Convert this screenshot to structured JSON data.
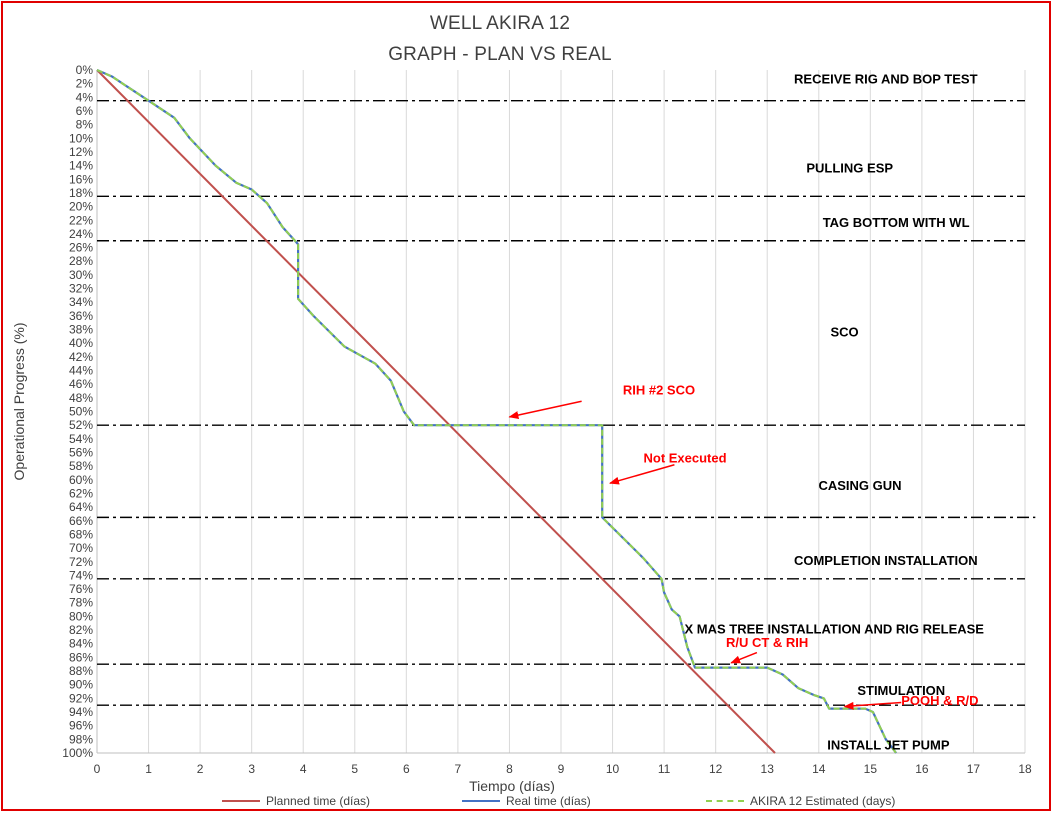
{
  "title_line1": "WELL AKIRA 12",
  "title_line2": "GRAPH  - PLAN VS REAL",
  "chart_data": {
    "type": "line",
    "title": "WELL AKIRA 12 GRAPH - PLAN VS REAL",
    "xlabel": "Tiempo (días)",
    "ylabel": "Operational Progress (%)",
    "xlim": [
      0,
      18
    ],
    "ylim": [
      0,
      100
    ],
    "y_inverted": true,
    "x_ticks": [
      0,
      1,
      2,
      3,
      4,
      5,
      6,
      7,
      8,
      9,
      10,
      11,
      12,
      13,
      14,
      15,
      16,
      17,
      18
    ],
    "y_ticks": [
      0,
      2,
      4,
      6,
      8,
      10,
      12,
      14,
      16,
      18,
      20,
      22,
      24,
      26,
      28,
      30,
      32,
      34,
      36,
      38,
      40,
      42,
      44,
      46,
      48,
      50,
      52,
      54,
      56,
      58,
      60,
      62,
      64,
      66,
      68,
      70,
      72,
      74,
      76,
      78,
      80,
      82,
      84,
      86,
      88,
      90,
      92,
      94,
      96,
      98,
      100
    ],
    "y_tick_suffix": "%",
    "grid": {
      "vertical": true,
      "horizontal": false
    },
    "legend_position": "bottom",
    "series": [
      {
        "name": "Planned time (días)",
        "color": "#c0504d",
        "style": "solid",
        "points": [
          [
            0,
            0
          ],
          [
            13.15,
            100
          ]
        ]
      },
      {
        "name": "Real time (días)",
        "color": "#4472c4",
        "style": "solid",
        "points": [
          [
            0,
            0
          ],
          [
            0.3,
            1
          ],
          [
            0.6,
            2.5
          ],
          [
            1.0,
            4.5
          ],
          [
            1.5,
            7
          ],
          [
            1.8,
            10
          ],
          [
            2.3,
            14
          ],
          [
            2.7,
            16.5
          ],
          [
            3.0,
            17.5
          ],
          [
            3.3,
            19.5
          ],
          [
            3.6,
            23
          ],
          [
            3.9,
            25.5
          ],
          [
            3.9,
            33.5
          ],
          [
            4.2,
            36
          ],
          [
            4.8,
            40.5
          ],
          [
            5.4,
            43
          ],
          [
            5.7,
            45.5
          ],
          [
            5.95,
            50
          ],
          [
            6.15,
            52
          ],
          [
            6.6,
            52
          ],
          [
            9.3,
            52
          ],
          [
            9.8,
            52
          ],
          [
            9.8,
            65.5
          ],
          [
            10.2,
            68.5
          ],
          [
            10.6,
            71.5
          ],
          [
            10.95,
            74.5
          ],
          [
            11.0,
            76.5
          ],
          [
            11.15,
            79
          ],
          [
            11.3,
            80
          ],
          [
            11.45,
            84.5
          ],
          [
            11.6,
            87.5
          ],
          [
            13.0,
            87.5
          ],
          [
            13.3,
            88.5
          ],
          [
            13.6,
            90.5
          ],
          [
            13.9,
            91.5
          ],
          [
            14.1,
            92
          ],
          [
            14.2,
            93.5
          ],
          [
            14.9,
            93.5
          ],
          [
            15.05,
            94
          ],
          [
            15.3,
            98
          ],
          [
            15.5,
            100
          ]
        ]
      },
      {
        "name": "AKIRA 12 Estimated (days)",
        "color": "#92d050",
        "style": "dashed",
        "points": [
          [
            0,
            0
          ],
          [
            0.3,
            1
          ],
          [
            0.6,
            2.5
          ],
          [
            1.0,
            4.5
          ],
          [
            1.5,
            7
          ],
          [
            1.8,
            10
          ],
          [
            2.3,
            14
          ],
          [
            2.7,
            16.5
          ],
          [
            3.0,
            17.5
          ],
          [
            3.3,
            19.5
          ],
          [
            3.6,
            23
          ],
          [
            3.9,
            25.5
          ],
          [
            3.9,
            33.5
          ],
          [
            4.2,
            36
          ],
          [
            4.8,
            40.5
          ],
          [
            5.4,
            43
          ],
          [
            5.7,
            45.5
          ],
          [
            5.95,
            50
          ],
          [
            6.15,
            52
          ],
          [
            6.6,
            52
          ],
          [
            9.3,
            52
          ],
          [
            9.8,
            52
          ],
          [
            9.8,
            65.5
          ],
          [
            10.2,
            68.5
          ],
          [
            10.6,
            71.5
          ],
          [
            10.95,
            74.5
          ],
          [
            11.0,
            76.5
          ],
          [
            11.15,
            79
          ],
          [
            11.3,
            80
          ],
          [
            11.45,
            84.5
          ],
          [
            11.6,
            87.5
          ],
          [
            13.0,
            87.5
          ],
          [
            13.3,
            88.5
          ],
          [
            13.6,
            90.5
          ],
          [
            13.9,
            91.5
          ],
          [
            14.1,
            92
          ],
          [
            14.2,
            93.5
          ],
          [
            14.9,
            93.5
          ],
          [
            15.05,
            94
          ],
          [
            15.3,
            98
          ],
          [
            15.5,
            100
          ]
        ]
      }
    ],
    "phase_boundaries": [
      {
        "y": 4.5,
        "x_end": 18
      },
      {
        "y": 18.5,
        "x_end": 18
      },
      {
        "y": 25,
        "x_end": 18
      },
      {
        "y": 52,
        "x_end": 18
      },
      {
        "y": 65.5,
        "x_end": 18.2
      },
      {
        "y": 74.5,
        "x_end": 18
      },
      {
        "y": 87,
        "x_end": 18
      },
      {
        "y": 93,
        "x_end": 18
      }
    ],
    "phases": [
      {
        "label": "RECEIVE RIG AND BOP TEST",
        "x": 15.3,
        "y": 2
      },
      {
        "label": "PULLING ESP",
        "x": 14.6,
        "y": 15
      },
      {
        "label": "TAG BOTTOM WITH WL",
        "x": 15.5,
        "y": 23
      },
      {
        "label": "SCO",
        "x": 14.5,
        "y": 39
      },
      {
        "label": "CASING GUN",
        "x": 14.8,
        "y": 61.5
      },
      {
        "label": "COMPLETION INSTALLATION",
        "x": 15.3,
        "y": 72.5
      },
      {
        "label": "X MAS TREE INSTALLATION AND RIG RELEASE",
        "x": 14.3,
        "y": 82.5
      },
      {
        "label": "STIMULATION",
        "x": 15.6,
        "y": 91.5
      },
      {
        "label": "INSTALL JET PUMP",
        "x": 15.35,
        "y": 99.5
      }
    ],
    "annotations": [
      {
        "label": "RIH #2 SCO",
        "text_x": 10.2,
        "text_y": 47.5,
        "arrow_from": [
          9.4,
          48.5
        ],
        "arrow_to": [
          8.0,
          50.8
        ]
      },
      {
        "label": "Not Executed",
        "text_x": 10.6,
        "text_y": 57.5,
        "arrow_from": [
          11.2,
          57.8
        ],
        "arrow_to": [
          9.95,
          60.5
        ]
      },
      {
        "label": "R/U CT & RIH",
        "text_x": 12.2,
        "text_y": 84.5,
        "arrow_from": [
          12.8,
          85.3
        ],
        "arrow_to": [
          12.3,
          86.8
        ]
      },
      {
        "label": "POOH & R/D",
        "text_x": 15.6,
        "text_y": 93,
        "arrow_from": [
          15.6,
          92.6
        ],
        "arrow_to": [
          14.5,
          93.2
        ]
      }
    ]
  }
}
